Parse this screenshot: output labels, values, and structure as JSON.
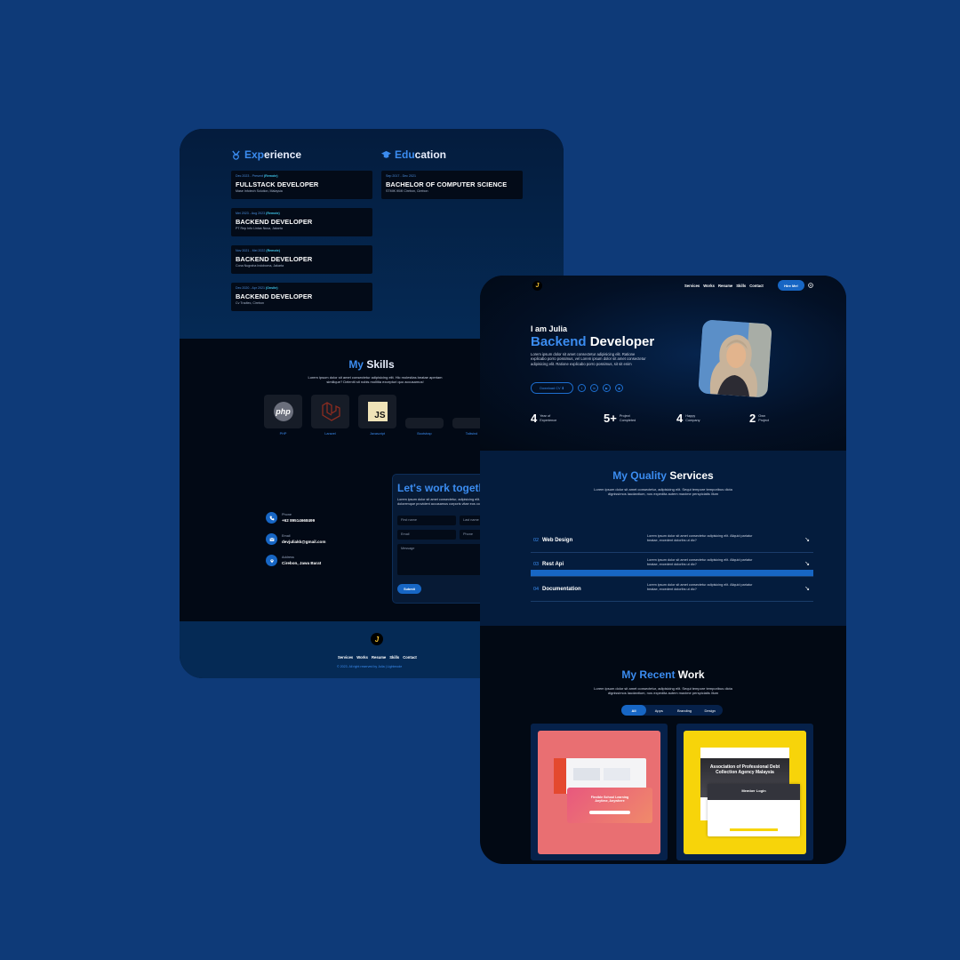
{
  "colors": {
    "background": "#0e3a78",
    "accent": "#3b8cf0",
    "button": "#1766c4",
    "card": "#020915"
  },
  "back": {
    "experience": {
      "heading_icon": "medal-icon",
      "heading_hl": "Exp",
      "heading_rest": "erience",
      "items": [
        {
          "date": "Dec 2023 - Present ",
          "tag": "(Remote)",
          "title": "FULLSTACK DEVELOPER",
          "company": "Mase Infotech Solution, Malaysia"
        },
        {
          "date": "Mei 2023 - Aug 2023 ",
          "tag": "(Remote)",
          "title": "BACKEND DEVELOPER",
          "company": "PT Rep Info Lintas Nusa, Jakarta"
        },
        {
          "date": "Nov 2021 - Mei 2022 ",
          "tag": "(Remote)",
          "title": "BACKEND DEVELOPER",
          "company": "Cona Nugraha Indoboma, Jakarta"
        },
        {
          "date": "Dec 2020 - Apr 2021 ",
          "tag": "(Onsite)",
          "title": "BACKEND DEVELOPER",
          "company": "Cv Tradtec, Cirebon"
        }
      ]
    },
    "education": {
      "heading_icon": "graduation-cap-icon",
      "heading_hl": "Edu",
      "heading_rest": "cation",
      "items": [
        {
          "date": "Sep 2017 - Dec 2021",
          "title": "BACHELOR OF COMPUTER SCIENCE",
          "school": "STMIK IKMI Cirebon, Cirebon"
        }
      ]
    },
    "skills": {
      "title_hl": "My ",
      "title_rest": "Skills",
      "desc": "Lorem ipsum dolor sit amet consectetur adipisicing elit. Hic molestias beatae aperiam similique? Deleniti sit nobis mollitia excepturi quo accusamus!",
      "items": [
        {
          "label": "PHP",
          "icon": "php-logo-icon",
          "logo_text": "php"
        },
        {
          "label": "Laravel",
          "icon": "laravel-logo-icon"
        },
        {
          "label": "Javascript",
          "icon": "javascript-logo-icon",
          "logo_text": "JS"
        },
        {
          "label": "Bootstrap",
          "icon": "bootstrap-logo-icon"
        },
        {
          "label": "Tailwind",
          "icon": "tailwind-logo-icon"
        }
      ]
    },
    "contact": {
      "items": [
        {
          "icon": "phone-icon",
          "label": "Phone",
          "value": "+62 89514668499"
        },
        {
          "icon": "mail-icon",
          "label": "Email",
          "value": "devjuliakk@gmail.com"
        },
        {
          "icon": "location-pin-icon",
          "label": "Address",
          "value": "Cirebon, Jawa Barat"
        }
      ],
      "form_title": "Let's work togeth",
      "form_desc": "Lorem ipsum dolor sit amet consectetur, adipisicing elit. Enim amet molestiae ipsa exercitationem accusantium doloremque provident accusamus corporis vitae eos consectetur accusamus blanditiis repellat?",
      "placeholders": {
        "first_name": "First name",
        "last_name": "Last name",
        "email": "Email",
        "phone": "Phone",
        "message": "Message"
      },
      "submit": "Submit"
    },
    "footer": {
      "nav": [
        "Services",
        "Works",
        "Resume",
        "Skills",
        "Contact"
      ],
      "copyright": "© 2023. All right reserved by Julia | Lightmode"
    }
  },
  "front": {
    "nav": [
      "Services",
      "Works",
      "Resume",
      "Skills",
      "Contact"
    ],
    "hire_button": "Hire Me!",
    "hero": {
      "greeting": "I am Julia",
      "role_hl": "Backend ",
      "role_rest": "Developer",
      "desc": "Lorem ipsum dolor sit amet consectetur adipisicing elit. Ratione explicabo porro possimus, vel Lorem ipsum dolor sit amet consectetur adipisicing elit. Ratione explicabo porro possimus, sit sit enim",
      "download_label": "Download CV",
      "social": [
        {
          "icon": "twitter-icon",
          "glyph": "t"
        },
        {
          "icon": "linkedin-icon",
          "glyph": "in"
        },
        {
          "icon": "youtube-icon",
          "glyph": "▶"
        },
        {
          "icon": "github-icon",
          "glyph": "◉"
        }
      ]
    },
    "stats": [
      {
        "value": "4",
        "line1": "Year of",
        "line2": "Experience"
      },
      {
        "value": "5+",
        "line1": "Project",
        "line2": "Completed"
      },
      {
        "value": "4",
        "line1": "Happy",
        "line2": "Company"
      },
      {
        "value": "2",
        "line1": "Own",
        "line2": "Project"
      }
    ],
    "services": {
      "title_hl": "My Quality ",
      "title_rest": "Services",
      "desc": "Lorem ipsum dolor sit amet consectetur, adipisicing elit. Sequi tempore temporibus dicta dignissimos laudantium, nos expedita autem maxime perspiciatis illum",
      "items": [
        {
          "num": "02",
          "name": "Web Design",
          "desc": "Lorem ipsum dolor sit amet consectetur adipisicing elit. Aliquid pariatur beatae, excedent doloribs ut dic?"
        },
        {
          "num": "03",
          "name": "Rest Api",
          "desc": "Lorem ipsum dolor sit amet consectetur adipisicing elit. Aliquid pariatur beatae, excedent doloribs ut dic?"
        },
        {
          "num": "04",
          "name": "Documentation",
          "desc": "Lorem ipsum dolor sit amet consectetur adipisicing elit. Aliquid pariatur beatae, excedent doloribs ut dic?"
        }
      ]
    },
    "works": {
      "title_hl": "My Recent ",
      "title_rest": "Work",
      "desc": "Lorem ipsum dolor sit amet consectetur, adipisicing elit. Sequi tempore temporibus dicta dignissimos laudantium, nos expedita autem maxime perspiciatis illum",
      "tabs": [
        "All",
        "Apps",
        "Branding",
        "Design"
      ],
      "projects": [
        {
          "headline": "Flexible School Learning Anytime, Anywhere"
        },
        {
          "headline": "Association of Professional Debt Collection Agency Malaysia",
          "sub": "Member Login"
        }
      ]
    }
  }
}
